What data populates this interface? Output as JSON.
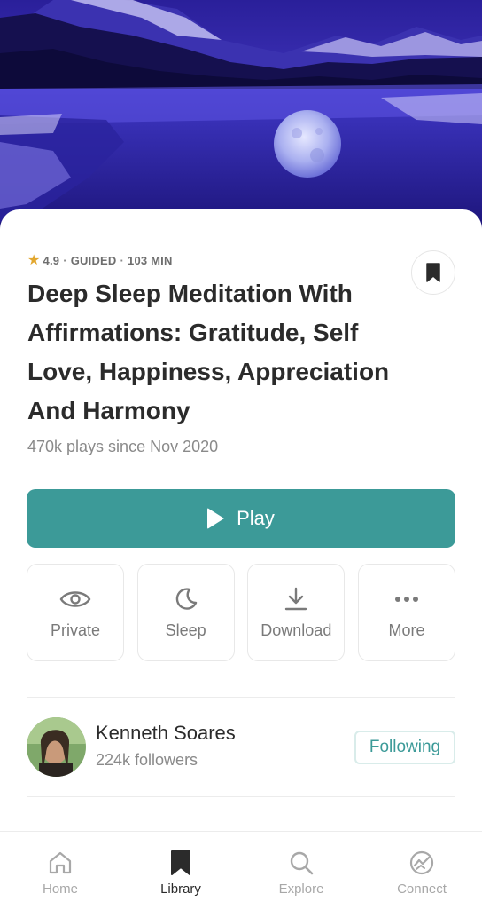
{
  "hero": {
    "image": "moonlit-lake-image"
  },
  "meta": {
    "rating": "4.9",
    "type": "GUIDED",
    "duration": "103 MIN",
    "separator": "·"
  },
  "track": {
    "title": "Deep Sleep Meditation With Affirmations: Gratitude, Self Love, Happiness, Appreciation And Harmony",
    "plays": "470k plays since Nov 2020"
  },
  "play_button": {
    "label": "Play"
  },
  "actions": [
    {
      "label": "Private",
      "icon": "eye-icon"
    },
    {
      "label": "Sleep",
      "icon": "moon-icon"
    },
    {
      "label": "Download",
      "icon": "download-icon"
    },
    {
      "label": "More",
      "icon": "more-dots-icon"
    }
  ],
  "author": {
    "name": "Kenneth Soares",
    "followers": "224k followers",
    "follow_label": "Following"
  },
  "tabs": [
    {
      "label": "Home",
      "icon": "home-icon"
    },
    {
      "label": "Library",
      "icon": "bookmark-icon",
      "active": true
    },
    {
      "label": "Explore",
      "icon": "search-icon"
    },
    {
      "label": "Connect",
      "icon": "connect-icon"
    }
  ],
  "colors": {
    "accent": "#3c9a98",
    "star": "#e2a72e"
  }
}
